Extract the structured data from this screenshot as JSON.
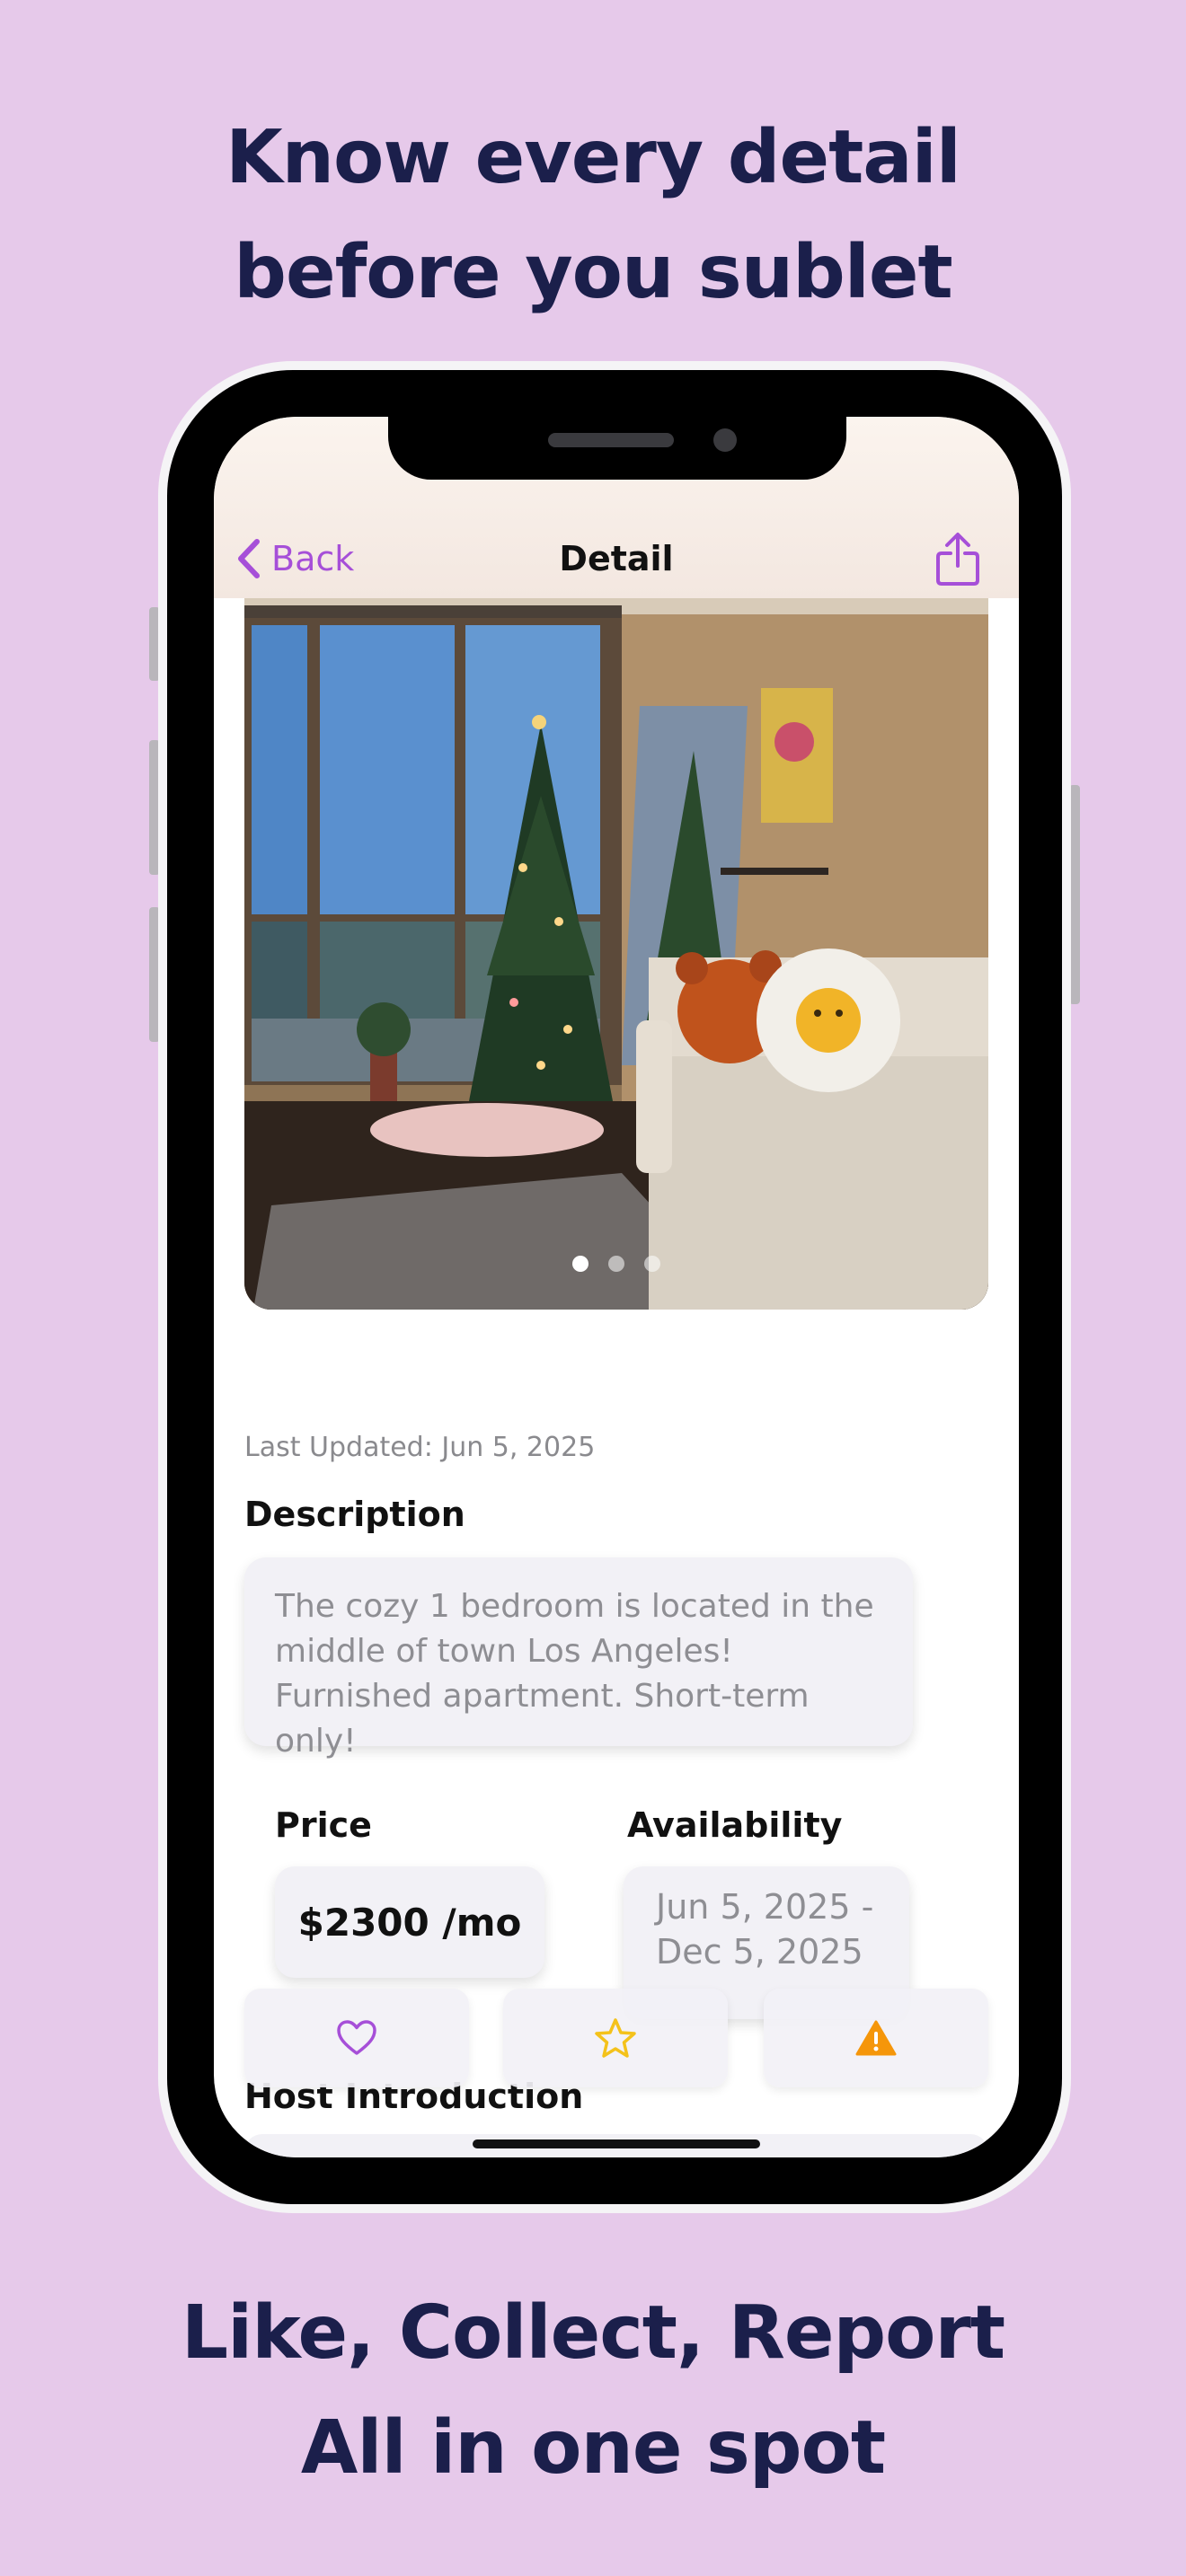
{
  "marketing": {
    "headline_top_line1": "Know every detail",
    "headline_top_line2": "before you sublet",
    "headline_bottom_line1": "Like, Collect, Report",
    "headline_bottom_line2": "All in one spot"
  },
  "nav": {
    "back_label": "Back",
    "title": "Detail",
    "share_icon": "share-icon"
  },
  "photo": {
    "page_count": 3,
    "current_page": 1
  },
  "listing": {
    "last_updated": "Last Updated: Jun 5, 2025",
    "description_label": "Description",
    "description_text": "The cozy 1 bedroom is located in the middle of town Los Angeles! Furnished apartment. Short-term only!",
    "price_label": "Price",
    "price_value": "$2300 /mo",
    "availability_label": "Availability",
    "availability_line1": "Jun 5, 2025 -",
    "availability_line2": "Dec 5, 2025",
    "host_label": "Host Introduction"
  },
  "actions": {
    "like_icon": "heart-icon",
    "collect_icon": "star-icon",
    "report_icon": "warning-icon"
  },
  "colors": {
    "background": "#e6c9ea",
    "headline": "#1b1f4b",
    "accent_purple": "#a64fd8",
    "star_yellow": "#f4c21b",
    "warning_orange": "#f5960a"
  }
}
